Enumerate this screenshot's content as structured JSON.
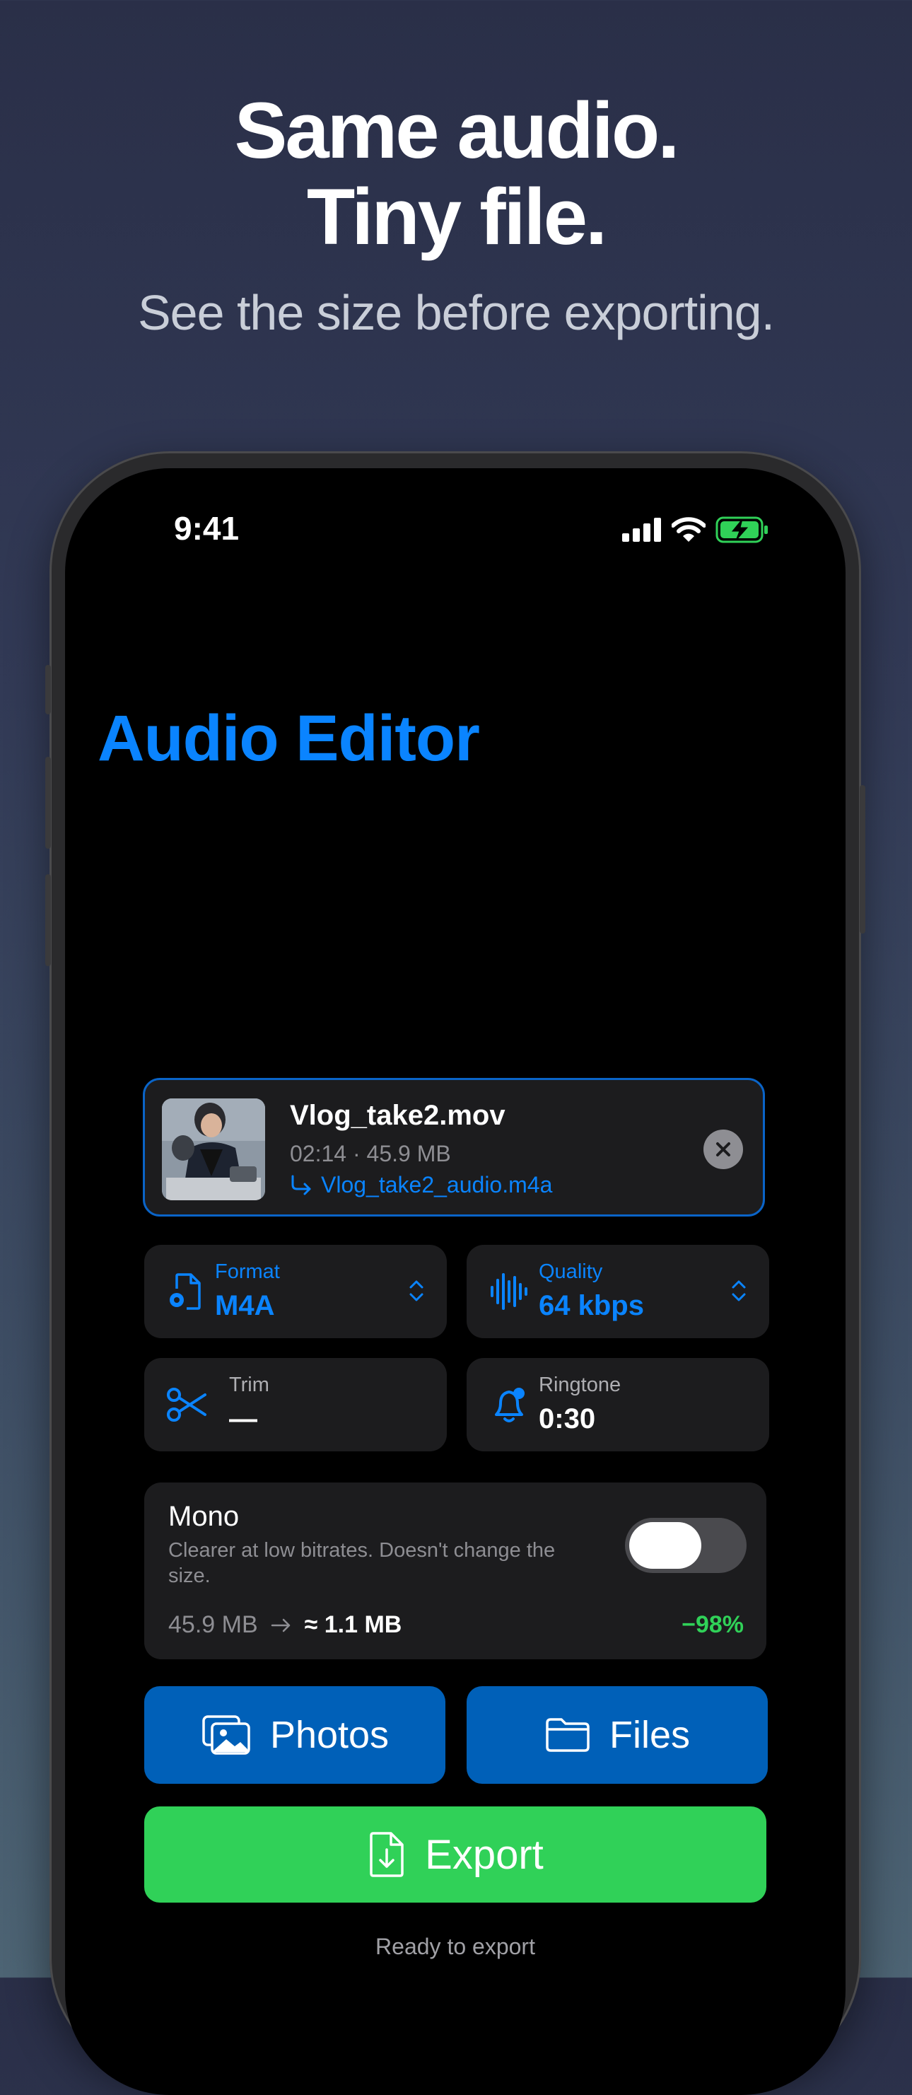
{
  "headline": {
    "line1": "Same audio.",
    "line2": "Tiny file.",
    "subtitle": "See the size before exporting."
  },
  "status_bar": {
    "time": "9:41",
    "icons": [
      "signal-icon",
      "wifi-icon",
      "battery-charging-icon"
    ]
  },
  "app": {
    "title": "Audio Editor"
  },
  "file": {
    "name": "Vlog_take2.mov",
    "meta": "02:14 · 45.9 MB",
    "output_name": "Vlog_take2_audio.m4a"
  },
  "settings": {
    "format": {
      "label": "Format",
      "value": "M4A"
    },
    "quality": {
      "label": "Quality",
      "value": "64 kbps"
    },
    "trim": {
      "label": "Trim",
      "value": "—"
    },
    "ringtone": {
      "label": "Ringtone",
      "value": "0:30"
    }
  },
  "mono": {
    "title": "Mono",
    "description": "Clearer at low bitrates. Doesn't change the size.",
    "enabled": false,
    "size_before": "45.9 MB",
    "size_after": "≈ 1.1 MB",
    "reduction": "−98%"
  },
  "actions": {
    "photos": "Photos",
    "files": "Files",
    "export": "Export"
  },
  "footer_status": "Ready to export",
  "colors": {
    "accent": "#0a84ff",
    "export_green": "#30d158",
    "button_blue": "#0060b8",
    "card_bg": "#1c1c1e"
  }
}
